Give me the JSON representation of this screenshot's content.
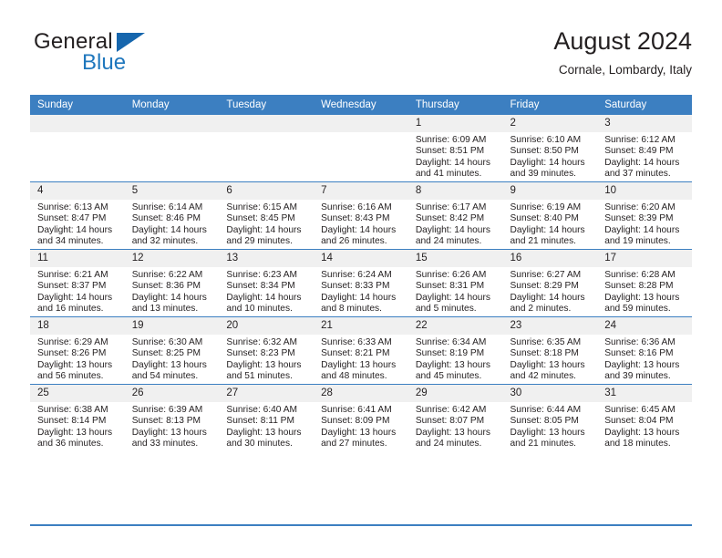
{
  "brand": {
    "name_part1": "General",
    "name_part2": "Blue",
    "logo_icon": "blue-triangle-icon",
    "color_primary": "#1666ad",
    "color_text": "#231f20"
  },
  "header": {
    "title": "August 2024",
    "subtitle": "Cornale, Lombardy, Italy"
  },
  "calendar": {
    "header_bg": "#3c7fc1",
    "daynum_bg": "#f0f0f0",
    "weekdays": [
      "Sunday",
      "Monday",
      "Tuesday",
      "Wednesday",
      "Thursday",
      "Friday",
      "Saturday"
    ],
    "weeks": [
      [
        {
          "day": "",
          "empty": true
        },
        {
          "day": "",
          "empty": true
        },
        {
          "day": "",
          "empty": true
        },
        {
          "day": "",
          "empty": true
        },
        {
          "day": "1",
          "sunrise": "Sunrise: 6:09 AM",
          "sunset": "Sunset: 8:51 PM",
          "daylight": "Daylight: 14 hours and 41 minutes."
        },
        {
          "day": "2",
          "sunrise": "Sunrise: 6:10 AM",
          "sunset": "Sunset: 8:50 PM",
          "daylight": "Daylight: 14 hours and 39 minutes."
        },
        {
          "day": "3",
          "sunrise": "Sunrise: 6:12 AM",
          "sunset": "Sunset: 8:49 PM",
          "daylight": "Daylight: 14 hours and 37 minutes."
        }
      ],
      [
        {
          "day": "4",
          "sunrise": "Sunrise: 6:13 AM",
          "sunset": "Sunset: 8:47 PM",
          "daylight": "Daylight: 14 hours and 34 minutes."
        },
        {
          "day": "5",
          "sunrise": "Sunrise: 6:14 AM",
          "sunset": "Sunset: 8:46 PM",
          "daylight": "Daylight: 14 hours and 32 minutes."
        },
        {
          "day": "6",
          "sunrise": "Sunrise: 6:15 AM",
          "sunset": "Sunset: 8:45 PM",
          "daylight": "Daylight: 14 hours and 29 minutes."
        },
        {
          "day": "7",
          "sunrise": "Sunrise: 6:16 AM",
          "sunset": "Sunset: 8:43 PM",
          "daylight": "Daylight: 14 hours and 26 minutes."
        },
        {
          "day": "8",
          "sunrise": "Sunrise: 6:17 AM",
          "sunset": "Sunset: 8:42 PM",
          "daylight": "Daylight: 14 hours and 24 minutes."
        },
        {
          "day": "9",
          "sunrise": "Sunrise: 6:19 AM",
          "sunset": "Sunset: 8:40 PM",
          "daylight": "Daylight: 14 hours and 21 minutes."
        },
        {
          "day": "10",
          "sunrise": "Sunrise: 6:20 AM",
          "sunset": "Sunset: 8:39 PM",
          "daylight": "Daylight: 14 hours and 19 minutes."
        }
      ],
      [
        {
          "day": "11",
          "sunrise": "Sunrise: 6:21 AM",
          "sunset": "Sunset: 8:37 PM",
          "daylight": "Daylight: 14 hours and 16 minutes."
        },
        {
          "day": "12",
          "sunrise": "Sunrise: 6:22 AM",
          "sunset": "Sunset: 8:36 PM",
          "daylight": "Daylight: 14 hours and 13 minutes."
        },
        {
          "day": "13",
          "sunrise": "Sunrise: 6:23 AM",
          "sunset": "Sunset: 8:34 PM",
          "daylight": "Daylight: 14 hours and 10 minutes."
        },
        {
          "day": "14",
          "sunrise": "Sunrise: 6:24 AM",
          "sunset": "Sunset: 8:33 PM",
          "daylight": "Daylight: 14 hours and 8 minutes."
        },
        {
          "day": "15",
          "sunrise": "Sunrise: 6:26 AM",
          "sunset": "Sunset: 8:31 PM",
          "daylight": "Daylight: 14 hours and 5 minutes."
        },
        {
          "day": "16",
          "sunrise": "Sunrise: 6:27 AM",
          "sunset": "Sunset: 8:29 PM",
          "daylight": "Daylight: 14 hours and 2 minutes."
        },
        {
          "day": "17",
          "sunrise": "Sunrise: 6:28 AM",
          "sunset": "Sunset: 8:28 PM",
          "daylight": "Daylight: 13 hours and 59 minutes."
        }
      ],
      [
        {
          "day": "18",
          "sunrise": "Sunrise: 6:29 AM",
          "sunset": "Sunset: 8:26 PM",
          "daylight": "Daylight: 13 hours and 56 minutes."
        },
        {
          "day": "19",
          "sunrise": "Sunrise: 6:30 AM",
          "sunset": "Sunset: 8:25 PM",
          "daylight": "Daylight: 13 hours and 54 minutes."
        },
        {
          "day": "20",
          "sunrise": "Sunrise: 6:32 AM",
          "sunset": "Sunset: 8:23 PM",
          "daylight": "Daylight: 13 hours and 51 minutes."
        },
        {
          "day": "21",
          "sunrise": "Sunrise: 6:33 AM",
          "sunset": "Sunset: 8:21 PM",
          "daylight": "Daylight: 13 hours and 48 minutes."
        },
        {
          "day": "22",
          "sunrise": "Sunrise: 6:34 AM",
          "sunset": "Sunset: 8:19 PM",
          "daylight": "Daylight: 13 hours and 45 minutes."
        },
        {
          "day": "23",
          "sunrise": "Sunrise: 6:35 AM",
          "sunset": "Sunset: 8:18 PM",
          "daylight": "Daylight: 13 hours and 42 minutes."
        },
        {
          "day": "24",
          "sunrise": "Sunrise: 6:36 AM",
          "sunset": "Sunset: 8:16 PM",
          "daylight": "Daylight: 13 hours and 39 minutes."
        }
      ],
      [
        {
          "day": "25",
          "sunrise": "Sunrise: 6:38 AM",
          "sunset": "Sunset: 8:14 PM",
          "daylight": "Daylight: 13 hours and 36 minutes."
        },
        {
          "day": "26",
          "sunrise": "Sunrise: 6:39 AM",
          "sunset": "Sunset: 8:13 PM",
          "daylight": "Daylight: 13 hours and 33 minutes."
        },
        {
          "day": "27",
          "sunrise": "Sunrise: 6:40 AM",
          "sunset": "Sunset: 8:11 PM",
          "daylight": "Daylight: 13 hours and 30 minutes."
        },
        {
          "day": "28",
          "sunrise": "Sunrise: 6:41 AM",
          "sunset": "Sunset: 8:09 PM",
          "daylight": "Daylight: 13 hours and 27 minutes."
        },
        {
          "day": "29",
          "sunrise": "Sunrise: 6:42 AM",
          "sunset": "Sunset: 8:07 PM",
          "daylight": "Daylight: 13 hours and 24 minutes."
        },
        {
          "day": "30",
          "sunrise": "Sunrise: 6:44 AM",
          "sunset": "Sunset: 8:05 PM",
          "daylight": "Daylight: 13 hours and 21 minutes."
        },
        {
          "day": "31",
          "sunrise": "Sunrise: 6:45 AM",
          "sunset": "Sunset: 8:04 PM",
          "daylight": "Daylight: 13 hours and 18 minutes."
        }
      ]
    ]
  }
}
